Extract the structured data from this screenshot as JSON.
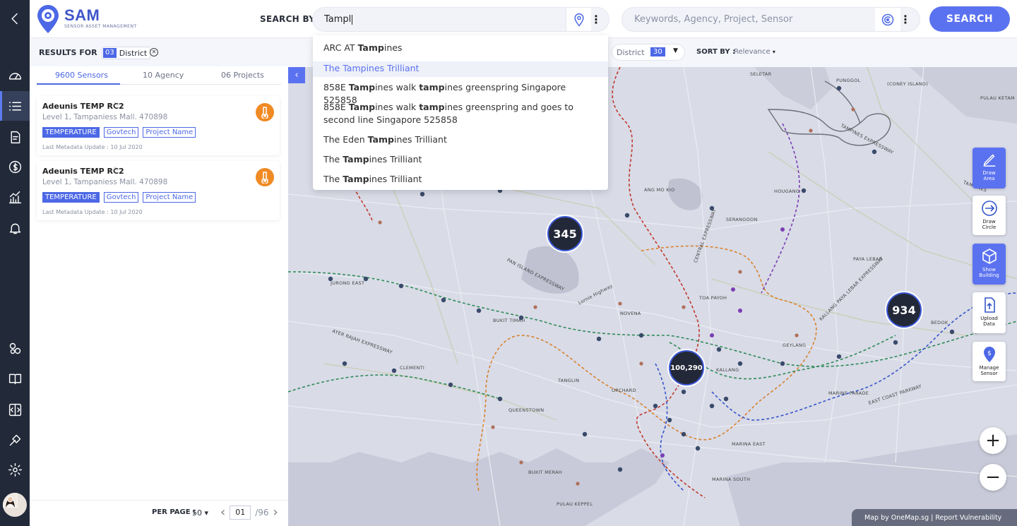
{
  "app": {
    "name": "SAM",
    "subtitle": "SENSOR ASSET MANAGEMENT"
  },
  "search": {
    "label": "SEARCH BY",
    "location_value": "Tampl",
    "keyword_placeholder": "Keywords, Agency, Project, Sensor",
    "button": "SEARCH",
    "suggestions": [
      {
        "pre": "ARC AT ",
        "bold": "Tamp",
        "post": "ines",
        "highlighted": false
      },
      {
        "pre": "The ",
        "bold": "Tamp",
        "post": "ines Trilliant",
        "highlighted": true
      },
      {
        "pre": "858E ",
        "bold": "Tamp",
        "post": "ines walk ",
        "bold2": "tamp",
        "post2": "ines greenspring Singapore 525858",
        "highlighted": false
      },
      {
        "pre": "858E ",
        "bold": "Tamp",
        "post": "ines walk ",
        "bold2": "tamp",
        "post2": "ines greenspring and goes to second line Singapore 525858",
        "highlighted": false
      },
      {
        "pre": "The Eden ",
        "bold": "Tamp",
        "post": "ines Trilliant",
        "highlighted": false
      },
      {
        "pre": "The ",
        "bold": "Tamp",
        "post": "ines Trilliant",
        "highlighted": false
      },
      {
        "pre": "The ",
        "bold": "Tamp",
        "post": "ines Trilliant",
        "highlighted": false
      }
    ]
  },
  "results": {
    "label": "RESULTS FOR",
    "chip_num": "03",
    "chip_text": "District"
  },
  "tabs": [
    {
      "label": "9600 Sensors",
      "active": true
    },
    {
      "label": "10 Agency",
      "active": false
    },
    {
      "label": "06 Projects",
      "active": false
    }
  ],
  "cards": [
    {
      "title": "Adeunis TEMP RC2",
      "address": "Level 1, Tampaniess Mall. 470898",
      "tags": [
        "TEMPERATURE",
        "Govtech",
        "Project Name"
      ],
      "meta": "Last Metadata Update : 10 Jul 2020"
    },
    {
      "title": "Adeunis TEMP RC2",
      "address": "Level 1, Tampaniess Mall. 470898",
      "tags": [
        "TEMPERATURE",
        "Govtech",
        "Project Name"
      ],
      "meta": "Last Metadata Update : 10 Jul 2020"
    }
  ],
  "pagination": {
    "per_page_label": "PER PAGE :",
    "per_page_value": "50",
    "page": "01",
    "total": "/96"
  },
  "filters": {
    "district_label": "District",
    "district_count": "30",
    "sort_label": "SORT BY :",
    "sort_value": "Relevance"
  },
  "map": {
    "clusters": [
      "345",
      "934",
      "100,290"
    ],
    "labels": [
      "SELETAR",
      "PUNGGOL",
      "(CONEY ISLAND)",
      "PULAU KETAM",
      "TAMPINES EXPRESSWAY",
      "HOUGANG",
      "ANG MO KIO",
      "SERANGOON",
      "CENTRAL EXPRESSWAY",
      "PAN ISLAND EXPRESSWAY",
      "JURONG EAST",
      "BUKIT TIMAH",
      "NOVENA",
      "TOA PAYOH",
      "PAYA LEBAR",
      "KALLANG PAYA LEBAR EXPRESSWAY",
      "AYER RAJAH EXPRESSWAY",
      "CLEMENTI",
      "TANGLIN",
      "ORCHARD",
      "GEYLANG",
      "BEDOK",
      "KALLANG",
      "MARINE PARADE",
      "EAST COAST PARKWAY",
      "QUEENSTOWN",
      "MARINA EAST",
      "BUKIT MERAH",
      "MARINA SOUTH",
      "PULAU KEPPEL",
      "Lornie Highway",
      "TAMPINES"
    ],
    "attribution": "Map by OneMap.sg  |  Report Vulnerability"
  },
  "tools": [
    {
      "label": "Draw Area"
    },
    {
      "label": "Draw Circle"
    },
    {
      "label": "Show Building"
    },
    {
      "label": "Upload Data"
    },
    {
      "label": "Manage Sensor"
    }
  ],
  "colors": {
    "accent": "#5b72f0",
    "nav": "#222a3a",
    "temp": "#f08a24"
  }
}
